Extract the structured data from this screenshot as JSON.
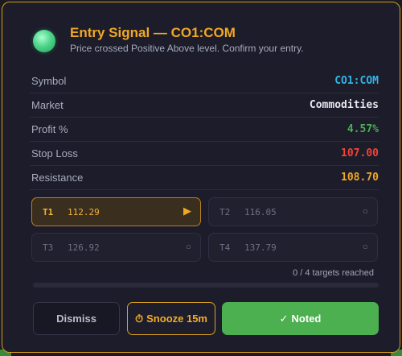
{
  "dialog": {
    "title": "Entry Signal — CO1:COM",
    "subtitle": "Price crossed Positive Above level. Confirm your entry."
  },
  "details": [
    {
      "label": "Symbol",
      "value": "CO1:COM",
      "color": "#33b5e5"
    },
    {
      "label": "Market",
      "value": "Commodities",
      "color": "#e6e8ef"
    },
    {
      "label": "Profit %",
      "value": "4.57%",
      "color": "#4caf50"
    },
    {
      "label": "Stop Loss",
      "value": "107.00",
      "color": "#f44336"
    },
    {
      "label": "Resistance",
      "value": "108.70",
      "color": "#f1a824"
    }
  ],
  "targets": [
    {
      "label": "T1",
      "price": "112.29",
      "status": "active",
      "icon": "play-icon",
      "glyph": "▶"
    },
    {
      "label": "T2",
      "price": "116.05",
      "status": "pending",
      "icon": "circle-icon",
      "glyph": "○"
    },
    {
      "label": "T3",
      "price": "126.92",
      "status": "pending",
      "icon": "circle-icon",
      "glyph": "○"
    },
    {
      "label": "T4",
      "price": "137.79",
      "status": "pending",
      "icon": "circle-icon",
      "glyph": "○"
    }
  ],
  "progress": {
    "text": "0 / 4 targets reached",
    "reached": 0,
    "total": 4
  },
  "actions": {
    "dismiss_label": "Dismiss",
    "snooze_icon": "⏱",
    "snooze_label": "Snooze 15m",
    "noted_icon": "✓",
    "noted_label": "Noted"
  },
  "colors": {
    "accent": "#f1a824",
    "positive": "#4caf50",
    "negative": "#f44336",
    "info": "#33b5e5"
  }
}
